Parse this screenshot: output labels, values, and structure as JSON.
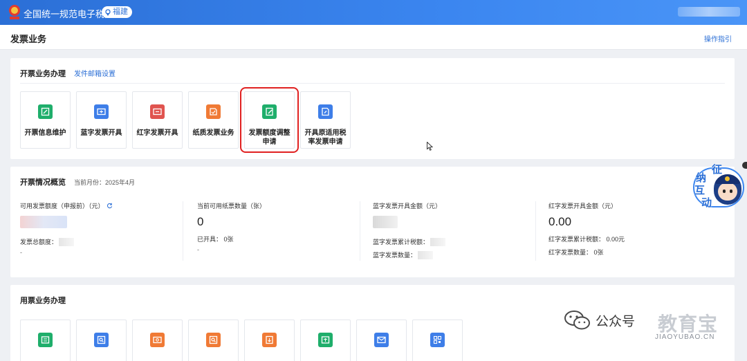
{
  "header": {
    "site_title": "全国统一规范电子税务局",
    "region": "福建"
  },
  "page": {
    "title": "发票业务",
    "guide": "操作指引"
  },
  "issue_section": {
    "title": "开票业务办理",
    "link": "发件邮箱设置",
    "tiles": [
      {
        "label": "开票信息维护",
        "icon": "edit-doc-icon",
        "color": "#1fae6b"
      },
      {
        "label": "蓝字发票开具",
        "icon": "ticket-icon",
        "color": "#3e7ee8"
      },
      {
        "label": "红字发票开具",
        "icon": "ticket-icon",
        "color": "#e0544f"
      },
      {
        "label": "纸质发票业务",
        "icon": "paper-icon",
        "color": "#f07a35"
      },
      {
        "label": "发票额度调整申请",
        "icon": "quota-edit-icon",
        "color": "#1fae6b"
      },
      {
        "label": "开具原适用税率发票申请",
        "icon": "apply-doc-icon",
        "color": "#3e7ee8"
      }
    ]
  },
  "overview": {
    "title": "开票情况概览",
    "month_label": "当前月份：2025年4月",
    "available_quota_label": "可用发票额度（申报前）（元）",
    "total_quota_label": "发票总额度：",
    "total_quota_dash": "-",
    "paper_count_label": "当前可用纸票数量（张）",
    "paper_count": "0",
    "issued_label": "已开具：",
    "issued_value": "0张",
    "paper_dash": "-",
    "blue_amount_label": "蓝字发票开具金额（元）",
    "blue_tax_label": "蓝字发票累计税额：",
    "blue_count_label": "蓝字发票数量：",
    "red_amount_label": "红字发票开具金额（元）",
    "red_amount": "0.00",
    "red_tax_label": "红字发票累计税额：",
    "red_tax_value": "0.00元",
    "red_count_label": "红字发票数量：",
    "red_count_value": "0张"
  },
  "usage_section": {
    "title": "用票业务办理",
    "tiles": [
      {
        "icon": "ticket-icon",
        "color": "#1fae6b"
      },
      {
        "icon": "search-doc-icon",
        "color": "#3e7ee8"
      },
      {
        "icon": "ticket-icon",
        "color": "#f07a35"
      },
      {
        "icon": "search-doc-icon",
        "color": "#f07a35"
      },
      {
        "icon": "download-icon",
        "color": "#f07a35"
      },
      {
        "icon": "ticket-icon",
        "color": "#1fae6b"
      },
      {
        "icon": "mail-icon",
        "color": "#3e7ee8"
      },
      {
        "icon": "qrcode-icon",
        "color": "#3e7ee8"
      }
    ]
  },
  "mascot": {
    "chars": [
      "征",
      "纳",
      "互",
      "动"
    ]
  },
  "watermark": {
    "text": "公众号",
    "brand": "教育宝",
    "url": "JIAOYUBAO.CN"
  }
}
